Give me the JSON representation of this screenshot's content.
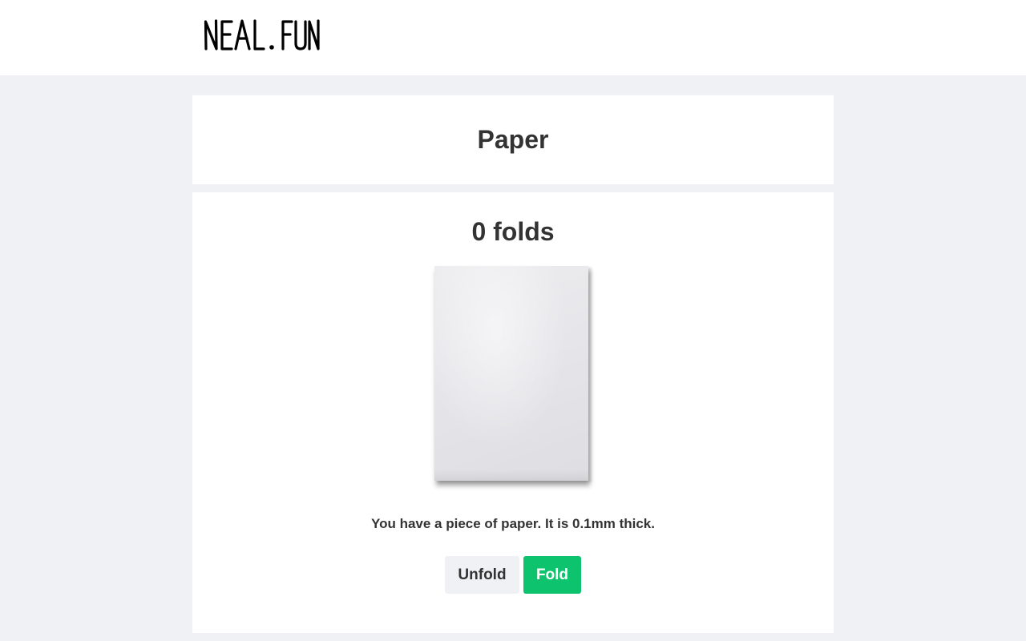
{
  "header": {
    "logo_text": "NEAL.FUN"
  },
  "page": {
    "title": "Paper"
  },
  "paper_game": {
    "fold_count_text": "0 folds",
    "description": "You have a piece of paper. It is 0.1mm thick.",
    "unfold_label": "Unfold",
    "fold_label": "Fold"
  },
  "colors": {
    "background": "#eff1f5",
    "card": "#ffffff",
    "text": "#333333",
    "fold_button": "#0ec36e",
    "unfold_button": "#eff1f5"
  }
}
